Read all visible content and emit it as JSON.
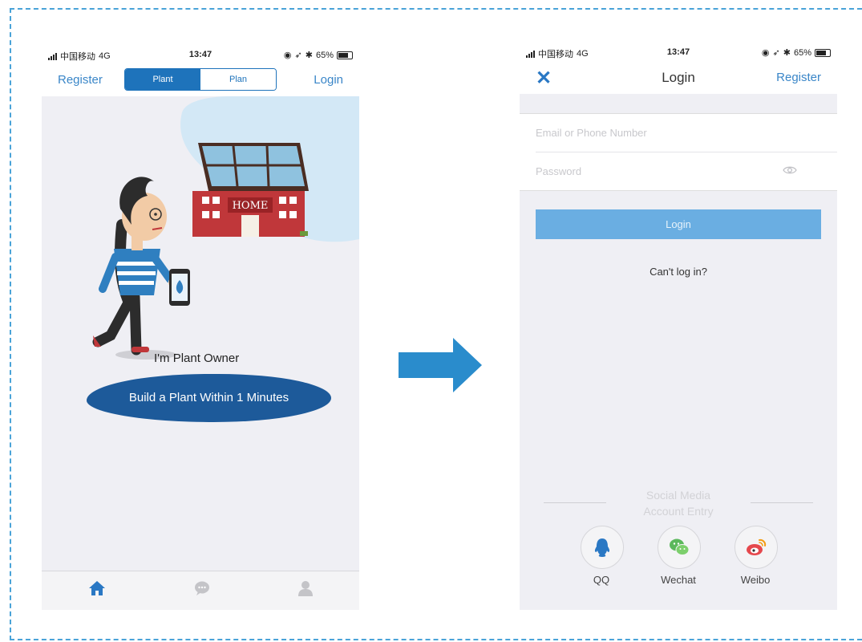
{
  "status_bar": {
    "carrier": "中国移动",
    "network": "4G",
    "time": "13:47",
    "battery": "65%"
  },
  "left_screen": {
    "nav": {
      "register": "Register",
      "login": "Login",
      "segments": [
        "Plant",
        "Plan"
      ],
      "selected_segment": "Plant"
    },
    "illustration": {
      "house_sign": "HOME"
    },
    "owner_label": "I'm Plant Owner",
    "build_button": "Build a Plant Within 1 Minutes",
    "tabbar": [
      "home-icon",
      "chat-icon",
      "user-icon"
    ]
  },
  "right_screen": {
    "nav": {
      "close": "✕",
      "title": "Login",
      "register": "Register"
    },
    "form": {
      "email_placeholder": "Email or Phone Number",
      "password_placeholder": "Password"
    },
    "login_button": "Login",
    "cant_login": "Can't log in?",
    "social": {
      "title_line1": "Social Media",
      "title_line2": "Account Entry",
      "items": [
        {
          "label": "QQ",
          "icon": "qq-icon"
        },
        {
          "label": "Wechat",
          "icon": "wechat-icon"
        },
        {
          "label": "Weibo",
          "icon": "weibo-icon"
        }
      ]
    }
  },
  "colors": {
    "accent": "#1e73bb",
    "link": "#3a86c8",
    "login_button": "#6aaee2",
    "arrow": "#2a8ccc",
    "frame": "#4aa3d8"
  }
}
